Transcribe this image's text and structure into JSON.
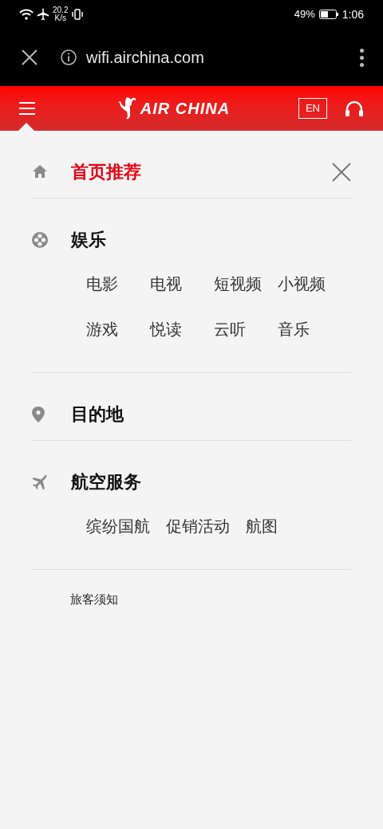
{
  "status_bar": {
    "speed": "20.2",
    "speed_unit": "K/s",
    "battery": "49%",
    "time": "1:06"
  },
  "browser": {
    "url": "wifi.airchina.com"
  },
  "header": {
    "logo": "AIR CHINA",
    "language": "EN"
  },
  "menu": {
    "sections": [
      {
        "kind": "home",
        "label": "首页推荐",
        "selected": true
      },
      {
        "kind": "entertainment",
        "label": "娱乐",
        "selected": false,
        "items": [
          "电影",
          "电视",
          "短视频",
          "小视频",
          "游戏",
          "悦读",
          "云听",
          "音乐"
        ]
      },
      {
        "kind": "destination",
        "label": "目的地",
        "selected": false
      },
      {
        "kind": "flight",
        "label": "航空服务",
        "selected": false,
        "items": [
          "缤纷国航",
          "促销活动",
          "航图"
        ]
      }
    ],
    "footer_link": "旅客须知"
  }
}
